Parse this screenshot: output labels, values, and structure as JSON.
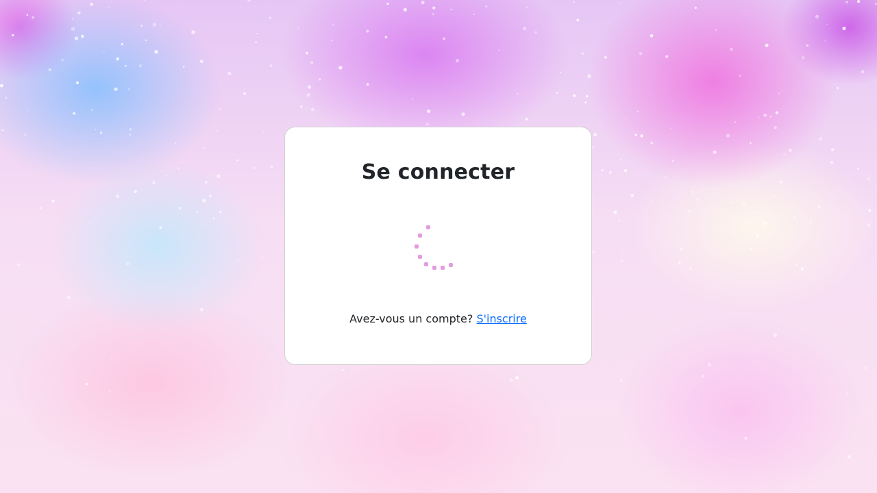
{
  "page": {
    "title": "Se connecter"
  },
  "loader": {
    "icon": "loading-spinner-icon",
    "color": "#e59be0"
  },
  "signup": {
    "prompt": "Avez-vous un compte?",
    "link_label": "S'inscrire",
    "link_color": "#0d6efd"
  },
  "colors": {
    "card_background": "#ffffff",
    "title_color": "#212529"
  }
}
